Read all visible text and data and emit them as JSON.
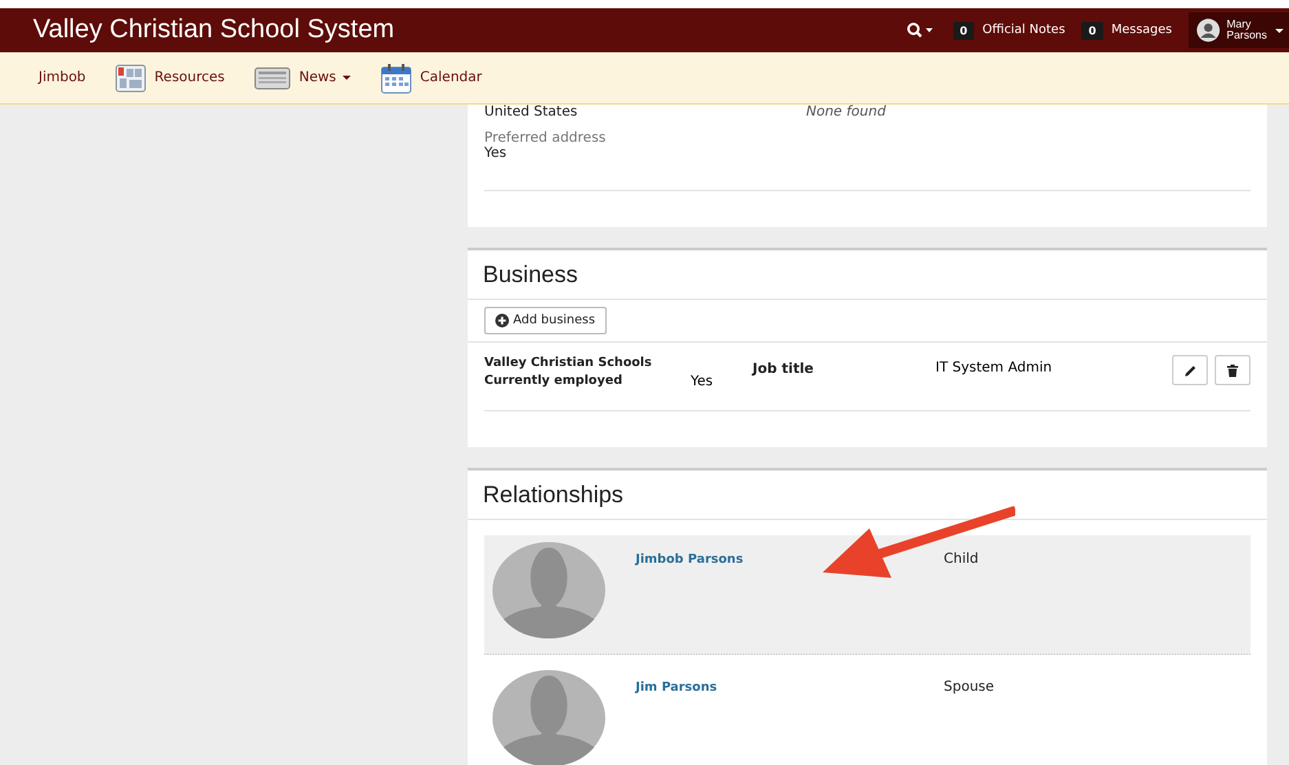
{
  "header": {
    "title": "Valley Christian School System",
    "notes": {
      "count": "0",
      "label": "Official Notes"
    },
    "messages": {
      "count": "0",
      "label": "Messages"
    },
    "user": {
      "first": "Mary",
      "last": "Parsons"
    }
  },
  "nav": [
    {
      "label": "Jimbob",
      "kind": "plain",
      "dropdown": false
    },
    {
      "label": "Resources",
      "kind": "resources",
      "dropdown": false
    },
    {
      "label": "News",
      "kind": "news",
      "dropdown": true
    },
    {
      "label": "Calendar",
      "kind": "calendar",
      "dropdown": false
    }
  ],
  "address": {
    "country": "United States",
    "other": "None found",
    "preferred_label": "Preferred address",
    "preferred_value": "Yes"
  },
  "business": {
    "title": "Business",
    "add_button": "Add business",
    "rows": [
      {
        "employer": "Valley Christian Schools",
        "employed_label": "Currently employed",
        "employed_value": "Yes",
        "job_label": "Job title",
        "job_value": "IT System Admin"
      }
    ]
  },
  "relationships": {
    "title": "Relationships",
    "rows": [
      {
        "name": "Jimbob Parsons",
        "relation": "Child",
        "selected": true
      },
      {
        "name": "Jim Parsons",
        "relation": "Spouse",
        "selected": false
      }
    ]
  }
}
